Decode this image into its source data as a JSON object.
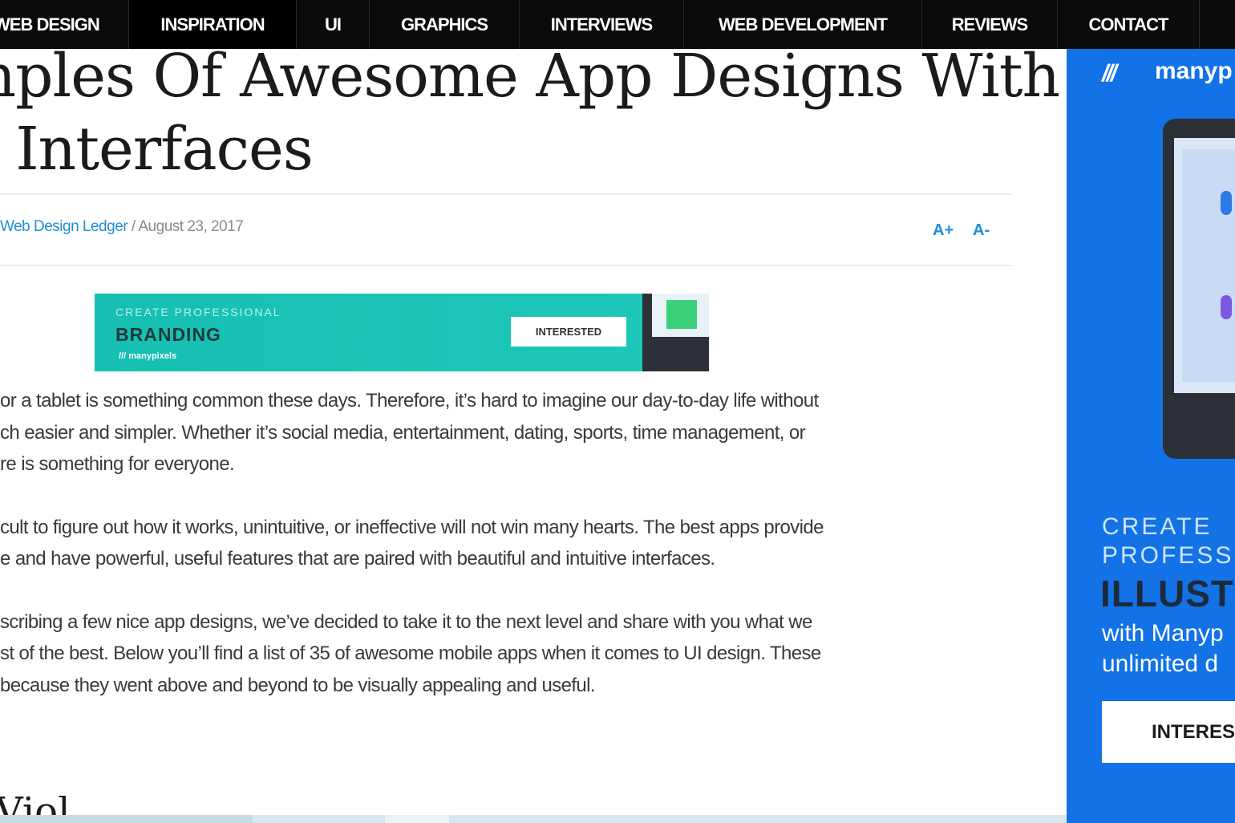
{
  "nav": {
    "items": [
      {
        "label": "WEB DESIGN"
      },
      {
        "label": "INSPIRATION"
      },
      {
        "label": "UI"
      },
      {
        "label": "GRAPHICS"
      },
      {
        "label": "INTERVIEWS"
      },
      {
        "label": "WEB DEVELOPMENT"
      },
      {
        "label": "REVIEWS"
      },
      {
        "label": "CONTACT"
      }
    ]
  },
  "article": {
    "title_line1": "mples Of Awesome App Designs With",
    "title_line2": "e Interfaces",
    "author": "Web Design Ledger",
    "date": " / August 23, 2017",
    "font_increase": "A+",
    "font_decrease": "A-",
    "paragraphs": [
      [
        " or a tablet is something common these days. Therefore, it’s hard to imagine our day-to-day life without",
        "ch easier and simpler. Whether it’s social media, entertainment, dating, sports, time management,  or",
        "re is something for everyone."
      ],
      [
        "cult to figure out how it works, unintuitive, or ineffective will not win many hearts. The best apps provide",
        "e and have powerful, useful features that are paired with beautiful and intuitive interfaces."
      ],
      [
        "scribing a few nice app designs, we’ve decided to take it to the next level and share with you what we",
        "st of the best. Below you’ll find a list of 35 of awesome mobile apps when it comes to UI design. These",
        " because they went above and beyond to be visually appealing and useful."
      ]
    ],
    "next_heading": "Viol"
  },
  "banner_ad": {
    "kicker": "CREATE PROFESSIONAL",
    "headline": "BRANDING",
    "brand": "/// manypixels",
    "cta": "INTERESTED",
    "ad_choices": "▷✕"
  },
  "sidebar_ad": {
    "logo_mark": "///",
    "logo_text": "manyp",
    "kicker_line1": "CREATE",
    "kicker_line2": "PROFESSI",
    "headline": "ILLUST",
    "sub_line1": "with Manyp",
    "sub_line2": "unlimited d",
    "cta": "INTERES",
    "background": "#1272e6"
  },
  "colors": {
    "nav_bg": "#0b0b0b",
    "link_blue": "#1f8ed8",
    "banner_teal": "#1dc8b8"
  }
}
